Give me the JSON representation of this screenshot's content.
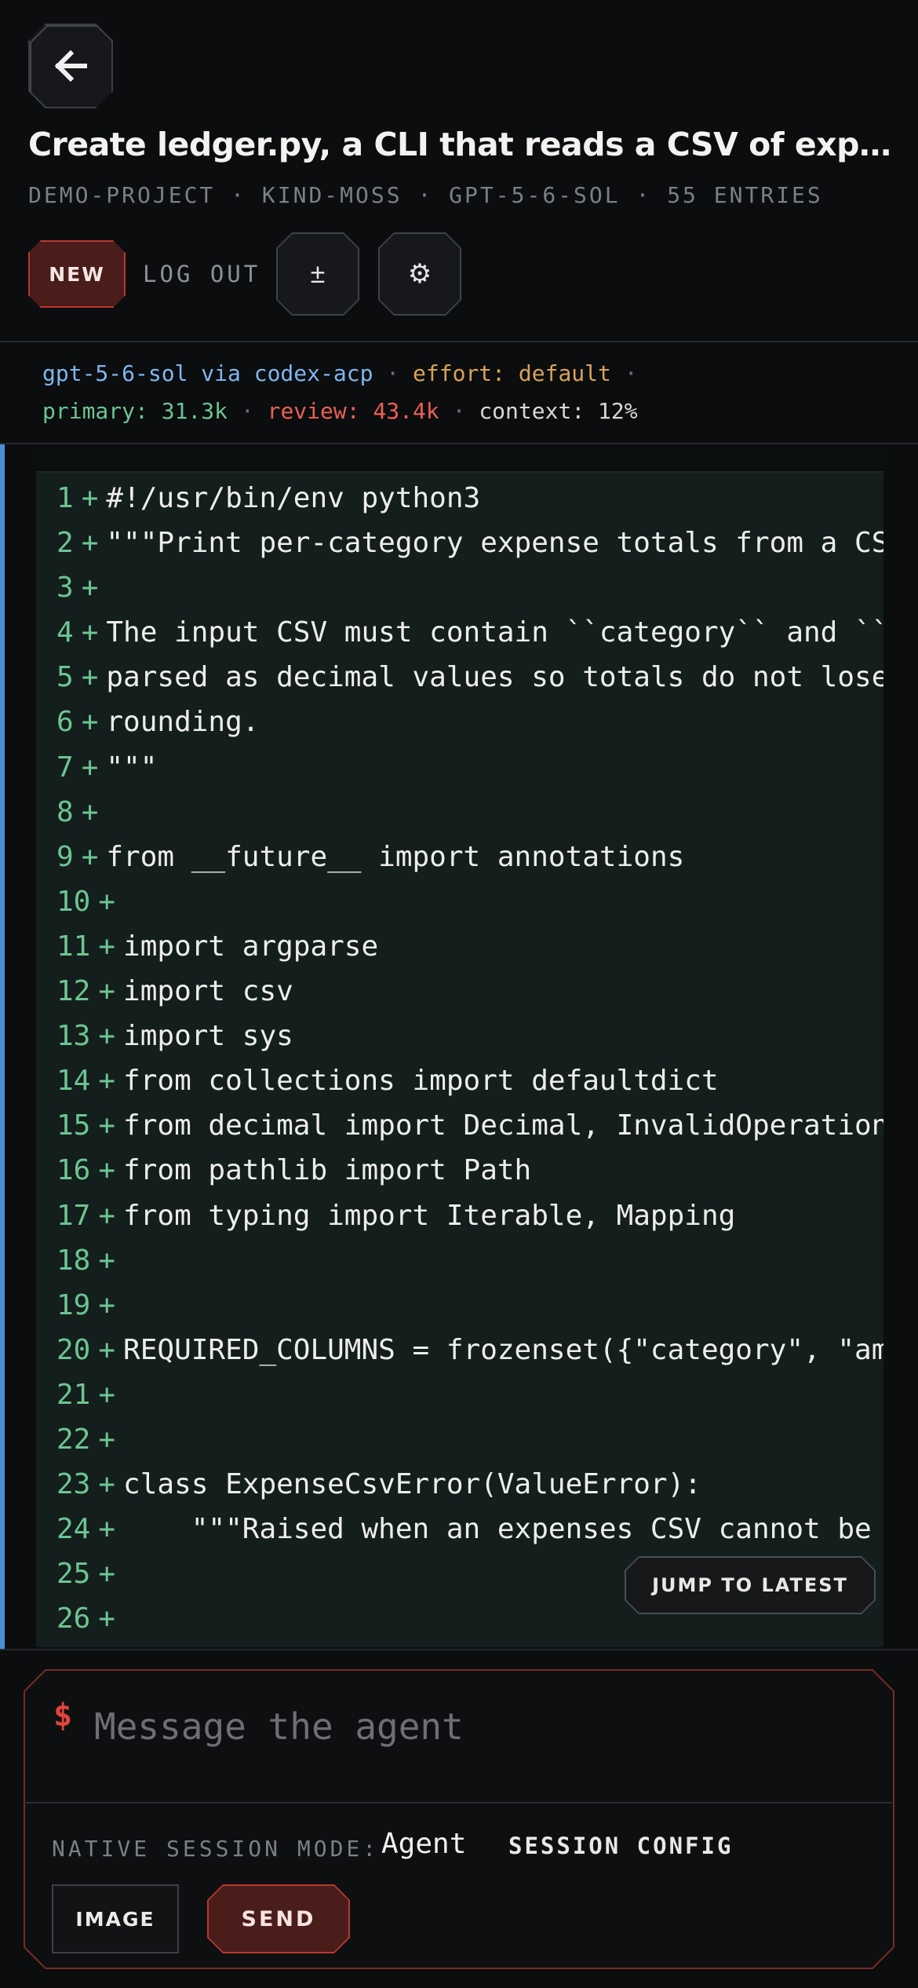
{
  "header": {
    "title": "Create ledger.py, a CLI that reads a CSV of expenses and prints per-category totals",
    "meta": {
      "project": "DEMO-PROJECT",
      "session": "KIND-MOSS",
      "model": "GPT-5-6-SOL",
      "entries": "55 ENTRIES",
      "separator": "·"
    },
    "back_icon": "arrow-left-icon",
    "new_label": "NEW",
    "logout_label": "LOG OUT",
    "diff_toggle_glyph": "±",
    "settings_glyph": "⚙"
  },
  "status": {
    "agent": "gpt-5-6-sol via codex-acp",
    "effort": "effort: default",
    "primary": "primary: 31.3k",
    "review": "review: 43.4k",
    "context": "context: 12%",
    "separator": "·"
  },
  "diff": {
    "marker": "+",
    "lines": [
      {
        "n": "1",
        "code": "#!/usr/bin/env python3"
      },
      {
        "n": "2",
        "code": "\"\"\"Print per-category expense totals from a CSV file."
      },
      {
        "n": "3",
        "code": ""
      },
      {
        "n": "4",
        "code": "The input CSV must contain ``category`` and ``amount`` columns. Amounts are"
      },
      {
        "n": "5",
        "code": "parsed as decimal values so totals do not lose precision to binary float"
      },
      {
        "n": "6",
        "code": "rounding."
      },
      {
        "n": "7",
        "code": "\"\"\""
      },
      {
        "n": "8",
        "code": ""
      },
      {
        "n": "9",
        "code": "from __future__ import annotations"
      },
      {
        "n": "10",
        "code": ""
      },
      {
        "n": "11",
        "code": "import argparse"
      },
      {
        "n": "12",
        "code": "import csv"
      },
      {
        "n": "13",
        "code": "import sys"
      },
      {
        "n": "14",
        "code": "from collections import defaultdict"
      },
      {
        "n": "15",
        "code": "from decimal import Decimal, InvalidOperation"
      },
      {
        "n": "16",
        "code": "from pathlib import Path"
      },
      {
        "n": "17",
        "code": "from typing import Iterable, Mapping"
      },
      {
        "n": "18",
        "code": ""
      },
      {
        "n": "19",
        "code": ""
      },
      {
        "n": "20",
        "code": "REQUIRED_COLUMNS = frozenset({\"category\", \"amount\"})"
      },
      {
        "n": "21",
        "code": ""
      },
      {
        "n": "22",
        "code": ""
      },
      {
        "n": "23",
        "code": "class ExpenseCsvError(ValueError):"
      },
      {
        "n": "24",
        "code": "    \"\"\"Raised when an expenses CSV cannot be processed.\"\"\""
      },
      {
        "n": "25",
        "code": ""
      },
      {
        "n": "26",
        "code": ""
      }
    ],
    "jump_label": "JUMP TO LATEST"
  },
  "composer": {
    "prompt_sign": "$",
    "placeholder": "Message the agent",
    "mode_label": "NATIVE SESSION MODE:",
    "mode_value": "Agent",
    "session_config_label": "SESSION CONFIG",
    "image_label": "IMAGE",
    "send_label": "SEND"
  },
  "colors": {
    "accent_red": "#b8382f",
    "accent_blue": "#4a90d9",
    "diff_green": "#6cc592",
    "amber": "#d9a356"
  }
}
